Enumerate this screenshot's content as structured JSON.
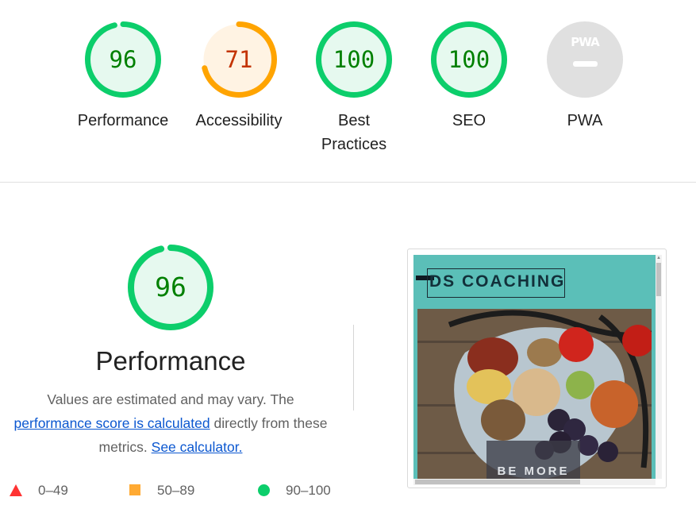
{
  "colors": {
    "pass": "#0cce6b",
    "pass_text": "#008000",
    "pass_bg": "#e6f9ef",
    "average": "#ffa400",
    "average_text": "#c33300",
    "average_bg": "#fff3e3",
    "fail": "#ff3333",
    "na": "#e0e0e0",
    "link": "#0b57d0"
  },
  "gauges": [
    {
      "score": "96",
      "label": "Performance",
      "level": 0.96,
      "rating": "pass"
    },
    {
      "score": "71",
      "label": "Accessibility",
      "level": 0.71,
      "rating": "average"
    },
    {
      "score": "100",
      "label": "Best Practices",
      "level": 1.0,
      "rating": "pass"
    },
    {
      "score": "100",
      "label": "SEO",
      "level": 1.0,
      "rating": "pass"
    },
    {
      "score": "",
      "label": "PWA",
      "badge": "PWA",
      "rating": "na"
    }
  ],
  "performance": {
    "score": "96",
    "level": 0.96,
    "title": "Performance",
    "desc_before": "Values are estimated and may vary. The ",
    "link_calc": "performance score is calculated",
    "desc_middle": " directly from these metrics. ",
    "link_calculator": "See calculator."
  },
  "legend": [
    {
      "shape": "triangle-icon",
      "label": "0–49"
    },
    {
      "shape": "square-icon",
      "label": "50–89"
    },
    {
      "shape": "circle-icon",
      "label": "90–100"
    }
  ],
  "screenshot": {
    "brand": "DS COACHING",
    "cta": "BE MORE"
  }
}
